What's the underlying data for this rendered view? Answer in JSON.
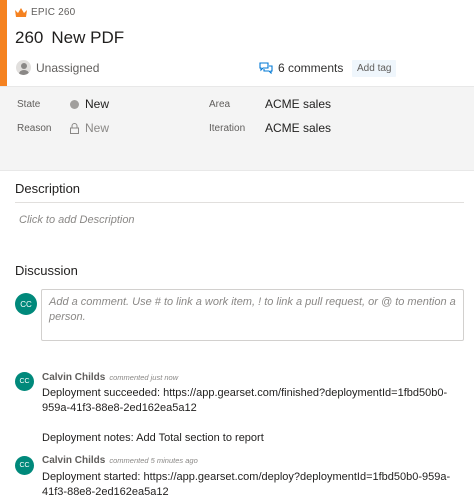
{
  "work_item": {
    "type_label": "EPIC 260",
    "id": "260",
    "title": "New PDF",
    "assignee": "Unassigned",
    "comments_count_label": "6 comments",
    "add_tag_label": "Add tag",
    "accent_color": "#f58220"
  },
  "fields": {
    "state": {
      "label": "State",
      "value": "New"
    },
    "reason": {
      "label": "Reason",
      "value": "New"
    },
    "area": {
      "label": "Area",
      "value": "ACME sales"
    },
    "iteration": {
      "label": "Iteration",
      "value": "ACME sales"
    }
  },
  "description": {
    "heading": "Description",
    "placeholder": "Click to add Description"
  },
  "discussion": {
    "heading": "Discussion",
    "composer_avatar_initials": "CC",
    "composer_placeholder": "Add a comment. Use # to link a work item, ! to link a pull request, or @ to mention a person.",
    "comments": [
      {
        "initials": "CC",
        "author": "Calvin Childs",
        "meta": "commented just now",
        "line1": "Deployment succeeded: https://app.gearset.com/finished?deploymentId=1fbd50b0-959a-41f3-88e8-2ed162ea5a12",
        "line2": "Deployment notes: Add Total section to report"
      },
      {
        "initials": "CC",
        "author": "Calvin Childs",
        "meta": "commented 5 minutes ago",
        "line1": "Deployment started: https://app.gearset.com/deploy?deploymentId=1fbd50b0-959a-41f3-88e8-2ed162ea5a12"
      }
    ]
  },
  "icons": {
    "type": "crown-icon",
    "assignee": "person-icon",
    "comments": "comment-icon",
    "reason": "lock-icon"
  }
}
